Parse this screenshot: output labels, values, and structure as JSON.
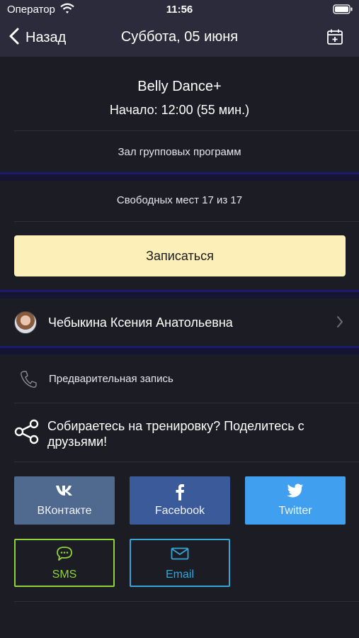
{
  "status_bar": {
    "carrier": "Оператор",
    "time": "11:56"
  },
  "nav": {
    "back_label": "Назад",
    "title": "Суббота, 05 июня"
  },
  "class": {
    "name": "Belly Dance+",
    "start": "Начало: 12:00 (55 мин.)",
    "hall": "Зал групповых программ",
    "places": "Свободных мест 17 из 17"
  },
  "signup_label": "Записаться",
  "trainer": {
    "name": "Чебыкина Ксения Анатольевна"
  },
  "booking": {
    "label": "Предварительная запись"
  },
  "share": {
    "text": "Собираетесь на тренировку? Поделитесь с друзьями!",
    "buttons": [
      {
        "label": "ВКонтакте",
        "icon": "vk-icon"
      },
      {
        "label": "Facebook",
        "icon": "facebook-icon"
      },
      {
        "label": "Twitter",
        "icon": "twitter-icon"
      },
      {
        "label": "SMS",
        "icon": "sms-icon"
      },
      {
        "label": "Email",
        "icon": "email-icon"
      }
    ]
  },
  "colors": {
    "background": "#1c1c25",
    "navbar": "#2b2b3b",
    "separator_band": "#151533",
    "signup_button": "#fdefb8",
    "vk": "#50698f",
    "facebook": "#3a5a99",
    "twitter": "#40a0ef",
    "sms": "#8fd33c",
    "email": "#37a5d6"
  }
}
